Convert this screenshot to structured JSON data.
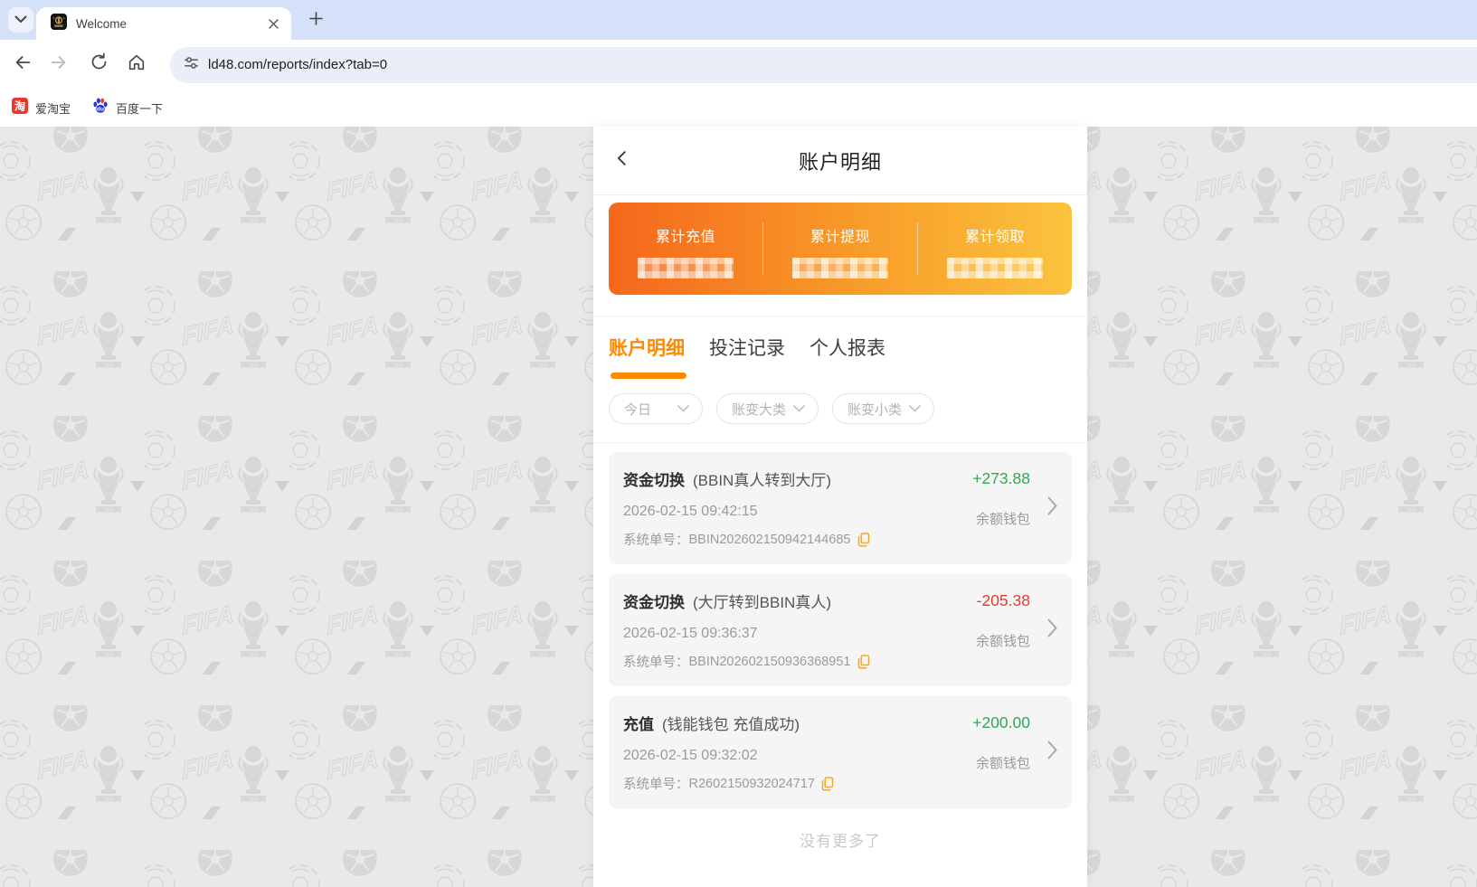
{
  "browser": {
    "tab": {
      "title": "Welcome",
      "favicon": "casino-gold-badge-icon",
      "close_icon": "close-icon"
    },
    "tabstrip_icons": {
      "tab_search": "chevron-down-icon",
      "new_tab": "plus-icon"
    },
    "toolbar_icons": [
      "back-icon",
      "forward-icon",
      "reload-icon",
      "home-icon"
    ],
    "omnibox": {
      "site_info_icon": "tune-icon",
      "url": "ld48.com/reports/index?tab=0"
    },
    "bookmarks": [
      {
        "icon": "taobao-icon",
        "icon_char": "淘",
        "label": "爱淘宝"
      },
      {
        "icon": "baidu-paw-icon",
        "icon_char": "du",
        "label": "百度一下"
      }
    ]
  },
  "page": {
    "title": "账户明细",
    "back_icon": "chevron-left-icon",
    "summary": {
      "items": [
        {
          "label": "累计充值",
          "value_masked": true
        },
        {
          "label": "累计提现",
          "value_masked": true
        },
        {
          "label": "累计领取",
          "value_masked": true
        }
      ]
    },
    "tabs": [
      {
        "label": "账户明细",
        "active": true
      },
      {
        "label": "投注记录",
        "active": false
      },
      {
        "label": "个人报表",
        "active": false
      }
    ],
    "filters": [
      {
        "label": "今日",
        "icon": "chevron-down-icon"
      },
      {
        "label": "账变大类",
        "icon": "chevron-down-icon"
      },
      {
        "label": "账变小类",
        "icon": "chevron-down-icon"
      }
    ],
    "transactions": [
      {
        "type": "资金切换",
        "detail": "(BBIN真人转到大厅)",
        "datetime": "2026-02-15 09:42:15",
        "order_label": "系统单号：",
        "order_no": "BBIN202602150942144685",
        "amount": "+273.88",
        "direction": "positive",
        "wallet": "余额钱包"
      },
      {
        "type": "资金切换",
        "detail": "(大厅转到BBIN真人)",
        "datetime": "2026-02-15 09:36:37",
        "order_label": "系统单号：",
        "order_no": "BBIN202602150936368951",
        "amount": "-205.38",
        "direction": "negative",
        "wallet": "余额钱包"
      },
      {
        "type": "充值",
        "detail": "(钱能钱包 充值成功)",
        "datetime": "2026-02-15 09:32:02",
        "order_label": "系统单号：",
        "order_no": "R2602150932024717",
        "amount": "+200.00",
        "direction": "positive",
        "wallet": "余额钱包"
      }
    ],
    "footer": "没有更多了",
    "background_watermark": [
      "soccer-ball-icon",
      "fifa-trophy-icon",
      "fifa-text",
      "club-world-cup-badge-icon"
    ]
  },
  "colors": {
    "accent_orange": "#ff8a00",
    "positive_green": "#33a852",
    "negative_red": "#e8392e",
    "gradient_start": "#f5671c",
    "gradient_end": "#fbc33d",
    "copy_icon_orange": "#f7a52d",
    "tabstrip_blue": "#d5e1f8",
    "page_bg": "#e9e9e9"
  }
}
